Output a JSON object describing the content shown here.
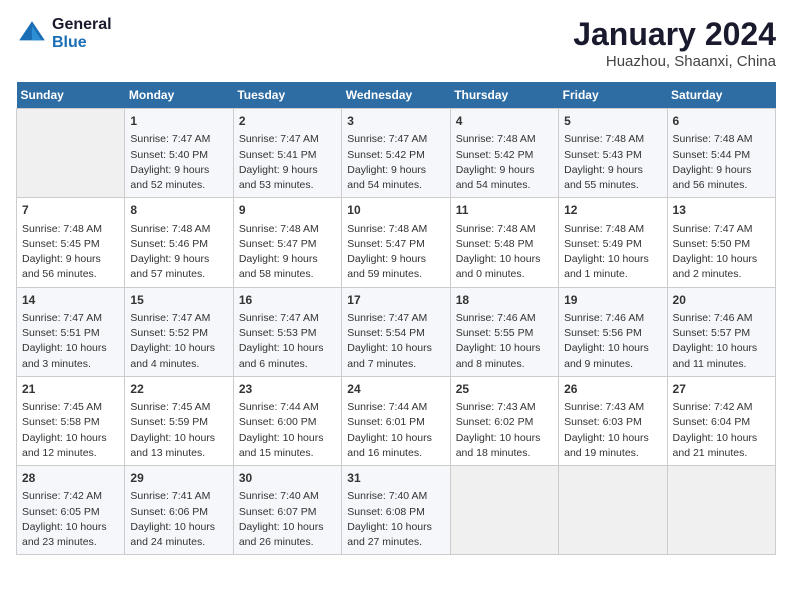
{
  "header": {
    "logo_line1": "General",
    "logo_line2": "Blue",
    "month_year": "January 2024",
    "location": "Huazhou, Shaanxi, China"
  },
  "days_of_week": [
    "Sunday",
    "Monday",
    "Tuesday",
    "Wednesday",
    "Thursday",
    "Friday",
    "Saturday"
  ],
  "weeks": [
    [
      {
        "num": "",
        "info": ""
      },
      {
        "num": "1",
        "info": "Sunrise: 7:47 AM\nSunset: 5:40 PM\nDaylight: 9 hours\nand 52 minutes."
      },
      {
        "num": "2",
        "info": "Sunrise: 7:47 AM\nSunset: 5:41 PM\nDaylight: 9 hours\nand 53 minutes."
      },
      {
        "num": "3",
        "info": "Sunrise: 7:47 AM\nSunset: 5:42 PM\nDaylight: 9 hours\nand 54 minutes."
      },
      {
        "num": "4",
        "info": "Sunrise: 7:48 AM\nSunset: 5:42 PM\nDaylight: 9 hours\nand 54 minutes."
      },
      {
        "num": "5",
        "info": "Sunrise: 7:48 AM\nSunset: 5:43 PM\nDaylight: 9 hours\nand 55 minutes."
      },
      {
        "num": "6",
        "info": "Sunrise: 7:48 AM\nSunset: 5:44 PM\nDaylight: 9 hours\nand 56 minutes."
      }
    ],
    [
      {
        "num": "7",
        "info": "Sunrise: 7:48 AM\nSunset: 5:45 PM\nDaylight: 9 hours\nand 56 minutes."
      },
      {
        "num": "8",
        "info": "Sunrise: 7:48 AM\nSunset: 5:46 PM\nDaylight: 9 hours\nand 57 minutes."
      },
      {
        "num": "9",
        "info": "Sunrise: 7:48 AM\nSunset: 5:47 PM\nDaylight: 9 hours\nand 58 minutes."
      },
      {
        "num": "10",
        "info": "Sunrise: 7:48 AM\nSunset: 5:47 PM\nDaylight: 9 hours\nand 59 minutes."
      },
      {
        "num": "11",
        "info": "Sunrise: 7:48 AM\nSunset: 5:48 PM\nDaylight: 10 hours\nand 0 minutes."
      },
      {
        "num": "12",
        "info": "Sunrise: 7:48 AM\nSunset: 5:49 PM\nDaylight: 10 hours\nand 1 minute."
      },
      {
        "num": "13",
        "info": "Sunrise: 7:47 AM\nSunset: 5:50 PM\nDaylight: 10 hours\nand 2 minutes."
      }
    ],
    [
      {
        "num": "14",
        "info": "Sunrise: 7:47 AM\nSunset: 5:51 PM\nDaylight: 10 hours\nand 3 minutes."
      },
      {
        "num": "15",
        "info": "Sunrise: 7:47 AM\nSunset: 5:52 PM\nDaylight: 10 hours\nand 4 minutes."
      },
      {
        "num": "16",
        "info": "Sunrise: 7:47 AM\nSunset: 5:53 PM\nDaylight: 10 hours\nand 6 minutes."
      },
      {
        "num": "17",
        "info": "Sunrise: 7:47 AM\nSunset: 5:54 PM\nDaylight: 10 hours\nand 7 minutes."
      },
      {
        "num": "18",
        "info": "Sunrise: 7:46 AM\nSunset: 5:55 PM\nDaylight: 10 hours\nand 8 minutes."
      },
      {
        "num": "19",
        "info": "Sunrise: 7:46 AM\nSunset: 5:56 PM\nDaylight: 10 hours\nand 9 minutes."
      },
      {
        "num": "20",
        "info": "Sunrise: 7:46 AM\nSunset: 5:57 PM\nDaylight: 10 hours\nand 11 minutes."
      }
    ],
    [
      {
        "num": "21",
        "info": "Sunrise: 7:45 AM\nSunset: 5:58 PM\nDaylight: 10 hours\nand 12 minutes."
      },
      {
        "num": "22",
        "info": "Sunrise: 7:45 AM\nSunset: 5:59 PM\nDaylight: 10 hours\nand 13 minutes."
      },
      {
        "num": "23",
        "info": "Sunrise: 7:44 AM\nSunset: 6:00 PM\nDaylight: 10 hours\nand 15 minutes."
      },
      {
        "num": "24",
        "info": "Sunrise: 7:44 AM\nSunset: 6:01 PM\nDaylight: 10 hours\nand 16 minutes."
      },
      {
        "num": "25",
        "info": "Sunrise: 7:43 AM\nSunset: 6:02 PM\nDaylight: 10 hours\nand 18 minutes."
      },
      {
        "num": "26",
        "info": "Sunrise: 7:43 AM\nSunset: 6:03 PM\nDaylight: 10 hours\nand 19 minutes."
      },
      {
        "num": "27",
        "info": "Sunrise: 7:42 AM\nSunset: 6:04 PM\nDaylight: 10 hours\nand 21 minutes."
      }
    ],
    [
      {
        "num": "28",
        "info": "Sunrise: 7:42 AM\nSunset: 6:05 PM\nDaylight: 10 hours\nand 23 minutes."
      },
      {
        "num": "29",
        "info": "Sunrise: 7:41 AM\nSunset: 6:06 PM\nDaylight: 10 hours\nand 24 minutes."
      },
      {
        "num": "30",
        "info": "Sunrise: 7:40 AM\nSunset: 6:07 PM\nDaylight: 10 hours\nand 26 minutes."
      },
      {
        "num": "31",
        "info": "Sunrise: 7:40 AM\nSunset: 6:08 PM\nDaylight: 10 hours\nand 27 minutes."
      },
      {
        "num": "",
        "info": ""
      },
      {
        "num": "",
        "info": ""
      },
      {
        "num": "",
        "info": ""
      }
    ]
  ]
}
